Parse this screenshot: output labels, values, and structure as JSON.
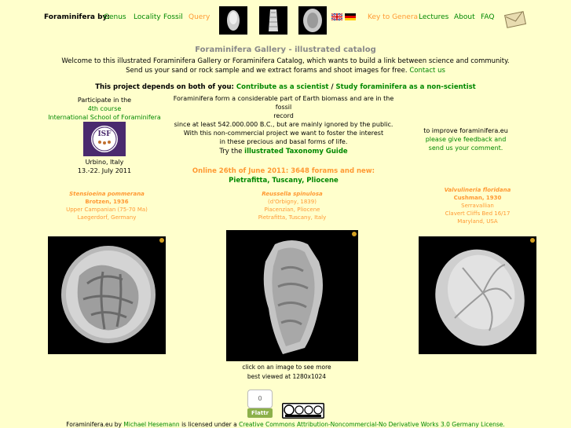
{
  "nav": {
    "brand": "Foraminifera by:",
    "items": [
      "Genus",
      "Locality",
      "Fossil",
      "Query"
    ],
    "right_items": [
      "Key to Genera",
      "Lectures",
      "About",
      "FAQ"
    ]
  },
  "title": "Foraminifera Gallery - illustrated catalog",
  "intro": {
    "line1": "Welcome to this illustrated Foraminifera Gallery or Foraminifera Catalog, which wants to build a link between science and community.",
    "line2": "Send us your sand or rock sample and we extract forams and shoot images for free.",
    "contact": "Contact us"
  },
  "depends": {
    "text": "This project depends on both of you:",
    "link1": "Contribute as a scientist",
    "sep": "/",
    "link2": "Study foraminifera as a non-scientist"
  },
  "left": {
    "line1": "Participate in the",
    "course": "4th course",
    "school": "International School of Foraminifera",
    "place": "Urbino, Italy",
    "dates": "13.-22. July 2011"
  },
  "middle": {
    "line1": "Foraminifera form a considerable part of Earth biomass and are in the fossil",
    "line2": "record",
    "line3": "since at least 542.000.000 B.C., but are mainly ignored by the public.",
    "line4": "With this non-commercial project we want to foster the interest",
    "line5": "in these precious and basal forms of life.",
    "try": "Try the",
    "guide": "illustrated Taxonomy Guide",
    "online": "Online 26th of June 2011: 3648 forams and new:",
    "new": "Pietrafitta, Tuscany, Pliocene"
  },
  "right": {
    "line1": "to improve foraminifera.eu",
    "line2": "please give feedback and",
    "line3": "send us your comment."
  },
  "specimens": [
    {
      "name": "Stensioeina pommerana",
      "author": "Brotzen, 1936",
      "line3": "Upper Campanian (75-70 Ma)",
      "line4": "Laegerdorf, Germany"
    },
    {
      "name": "Reussella spinulosa",
      "author": "(d'Orbigny, 1839)",
      "line3": "Piacenzian, Pliocene",
      "line4": "Pietrafitta, Tuscany, Italy"
    },
    {
      "name": "Valvulineria floridana",
      "author": "Cushman, 1930",
      "line3": "Serravallian",
      "line4": "Clavert Cliffs Bed 16/17",
      "line5": "Maryland, USA"
    }
  ],
  "below": {
    "click": "click on an image to see more",
    "best": "best viewed at 1280x1024"
  },
  "flattr": {
    "count": "0",
    "label": "Flattr"
  },
  "footer": {
    "site": "Foraminifera.eu by",
    "author": "Michael Hesemann",
    "mid": "is licensed under a",
    "license": "Creative Commons Attribution-Noncommercial-No Derivative Works 3.0 Germany License."
  },
  "colors": {
    "background": "#ffffcc",
    "link": "#008800",
    "accent": "#ff9933"
  }
}
